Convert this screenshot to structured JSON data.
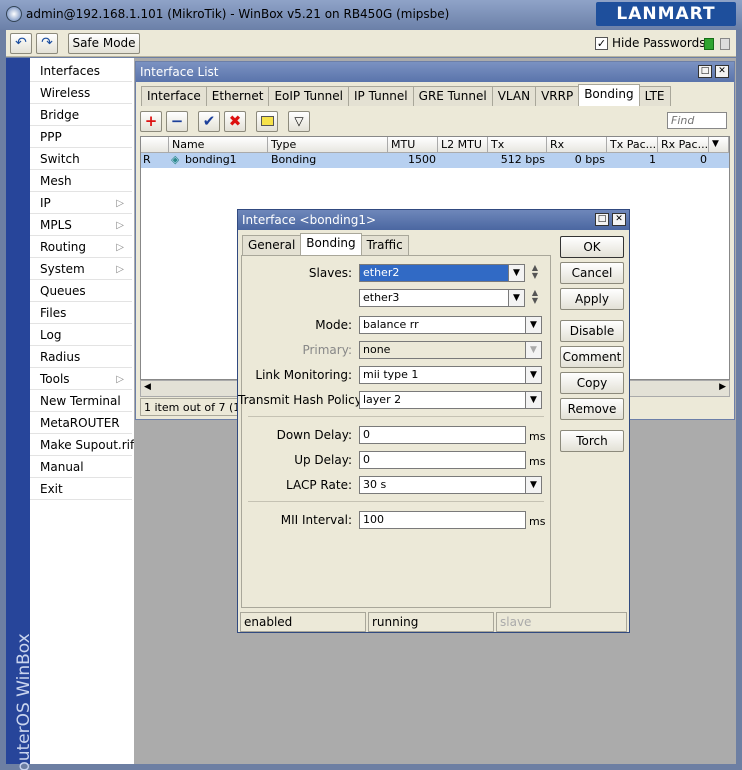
{
  "titlebar": {
    "title": "admin@192.168.1.101 (MikroTik) - WinBox v5.21 on RB450G (mipsbe)",
    "brand": "LANMART"
  },
  "toolbar": {
    "safe_mode": "Safe Mode",
    "hide_passwords": "Hide Passwords",
    "hide_passwords_checked": "✓"
  },
  "sidebar": {
    "brand_text": "RouterOS WinBox",
    "items": [
      {
        "label": "Interfaces"
      },
      {
        "label": "Wireless"
      },
      {
        "label": "Bridge"
      },
      {
        "label": "PPP"
      },
      {
        "label": "Switch"
      },
      {
        "label": "Mesh"
      },
      {
        "label": "IP",
        "submenu": true
      },
      {
        "label": "MPLS",
        "submenu": true
      },
      {
        "label": "Routing",
        "submenu": true
      },
      {
        "label": "System",
        "submenu": true
      },
      {
        "label": "Queues"
      },
      {
        "label": "Files"
      },
      {
        "label": "Log"
      },
      {
        "label": "Radius"
      },
      {
        "label": "Tools",
        "submenu": true
      },
      {
        "label": "New Terminal"
      },
      {
        "label": "MetaROUTER"
      },
      {
        "label": "Make Supout.rif"
      },
      {
        "label": "Manual"
      },
      {
        "label": "Exit"
      }
    ]
  },
  "interface_list": {
    "title": "Interface List",
    "tabs": [
      "Interface",
      "Ethernet",
      "EoIP Tunnel",
      "IP Tunnel",
      "GRE Tunnel",
      "VLAN",
      "VRRP",
      "Bonding",
      "LTE"
    ],
    "active_tab": "Bonding",
    "find_placeholder": "Find",
    "columns": [
      "Name",
      "Type",
      "MTU",
      "L2 MTU",
      "Tx",
      "Rx",
      "Tx Pac...",
      "Rx Pac..."
    ],
    "rows": [
      {
        "flag": "R",
        "name": "bonding1",
        "type": "Bonding",
        "mtu": "1500",
        "l2mtu": "",
        "tx": "512 bps",
        "rx": "0 bps",
        "txp": "1",
        "rxp": "0"
      }
    ],
    "status": "1 item out of 7 (1 sel"
  },
  "dialog": {
    "title": "Interface <bonding1>",
    "tabs": [
      "General",
      "Bonding",
      "Traffic"
    ],
    "active_tab": "Bonding",
    "fields": {
      "slaves_label": "Slaves:",
      "slave1": "ether2",
      "slave2": "ether3",
      "mode_label": "Mode:",
      "mode": "balance rr",
      "primary_label": "Primary:",
      "primary": "none",
      "link_label": "Link Monitoring:",
      "link": "mii type 1",
      "hash_label": "Transmit Hash Policy:",
      "hash": "layer 2",
      "down_label": "Down Delay:",
      "down": "0",
      "up_label": "Up Delay:",
      "up": "0",
      "lacp_label": "LACP Rate:",
      "lacp": "30 s",
      "mii_label": "MII Interval:",
      "mii": "100",
      "unit_ms": "ms"
    },
    "buttons": {
      "ok": "OK",
      "cancel": "Cancel",
      "apply": "Apply",
      "disable": "Disable",
      "comment": "Comment",
      "copy": "Copy",
      "remove": "Remove",
      "torch": "Torch"
    },
    "status": {
      "enabled": "enabled",
      "running": "running",
      "slave": "slave"
    }
  },
  "colors": {
    "accent": "#5a74ab",
    "selection": "#b7d0f0",
    "sideband": "#27459a"
  }
}
